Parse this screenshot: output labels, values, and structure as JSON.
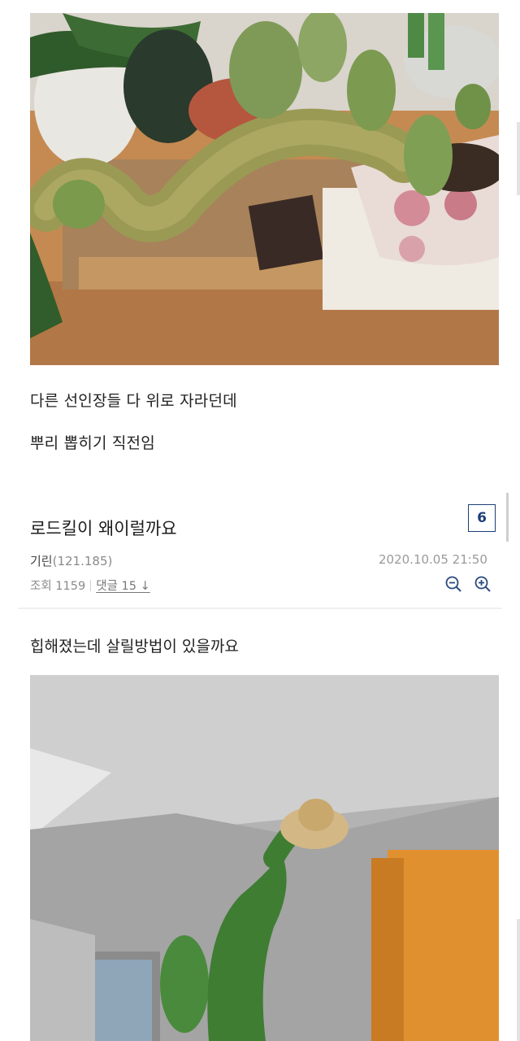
{
  "previous_post": {
    "lines": [
      "다른 선인장들 다 위로 자라던데",
      "뿌리 뽑히기 직전임"
    ]
  },
  "post": {
    "title": "로드킬이 왜이럴까요",
    "badge": "6",
    "author_name": "기린",
    "author_ip": "(121.185)",
    "date": "2020.10.05 21:50",
    "views_label": "조회 1159",
    "comments_label": "댓글 15",
    "comments_arrow": "↓",
    "content_line": "힙해졌는데 살릴방법이 있을까요"
  },
  "icons": [
    "zoom-out-icon",
    "zoom-in-icon"
  ],
  "colors": {
    "badge": "#1c3f77",
    "zoom_icon": "#2a4a80",
    "muted_text": "#8a8a8a"
  }
}
